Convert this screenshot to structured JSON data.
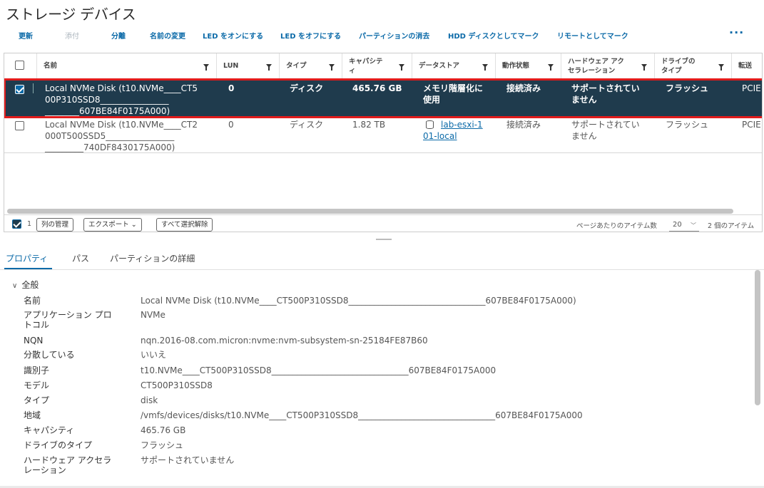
{
  "page": {
    "title": "ストレージ デバイス"
  },
  "toolbar": {
    "refresh": "更新",
    "attach": "添付",
    "detach": "分離",
    "rename": "名前の変更",
    "led_on": "LED をオンにする",
    "led_off": "LED をオフにする",
    "erase_partitions": "パーティションの消去",
    "mark_hdd": "HDD ディスクとしてマーク",
    "mark_remote": "リモートとしてマーク",
    "more": "⋮"
  },
  "grid": {
    "columns": {
      "name": "名前",
      "lun": "LUN",
      "type": "タイプ",
      "capacity": "キャパシティ",
      "datastore": "データストア",
      "op_state": "動作状態",
      "hw_accel": "ハードウェア アクセラレーション",
      "drive_type": "ドライブのタイプ",
      "transport": "転送"
    },
    "rows": [
      {
        "selected": true,
        "name_line1": "Local NVMe Disk (t10.NVMe____CT5",
        "name_line2": "00P310SSD8________________",
        "name_line3": "________607BE84F0175A000)",
        "lun": "0",
        "type": "ディスク",
        "capacity": "465.76 GB",
        "datastore_line1": "メモリ階層化に",
        "datastore_line2": "使用",
        "op_state": "接続済み",
        "hw_accel_line1": "サポートされてい",
        "hw_accel_line2": "ません",
        "drive_type": "フラッシュ",
        "transport": "PCIE"
      },
      {
        "selected": false,
        "name_line1": "Local NVMe Disk (t10.NVMe____CT2",
        "name_line2": "000T500SSD5________________",
        "name_line3": "_________740DF8430175A000)",
        "lun": "0",
        "type": "ディスク",
        "capacity": "1.82 TB",
        "datastore_line1": "lab-esxi-1",
        "datastore_line2": "01-local",
        "op_state": "接続済み",
        "hw_accel_line1": "サポートされてい",
        "hw_accel_line2": "ません",
        "drive_type": "フラッシュ",
        "transport": "PCIE"
      }
    ],
    "footer": {
      "selected_count": "1",
      "manage_columns": "列の管理",
      "export": "エクスポート ⌄",
      "clear_selection": "すべて選択解除",
      "items_per_page_label": "ページあたりのアイテム数",
      "items_per_page": "20",
      "total_items": "2 個のアイテム"
    }
  },
  "tabs": {
    "properties": "プロパティ",
    "paths": "パス",
    "partition_details": "パーティションの詳細"
  },
  "properties": {
    "section": "全般",
    "items": [
      {
        "label": "名前",
        "value": "Local NVMe Disk (t10.NVMe____CT500P310SSD8________________________________607BE84F0175A000)"
      },
      {
        "label": "アプリケーション プロトコル",
        "value": "NVMe"
      },
      {
        "label": "NQN",
        "value": "nqn.2016-08.com.micron:nvme:nvm-subsystem-sn-25184FE87B60"
      },
      {
        "label": "分散している",
        "value": "いいえ"
      },
      {
        "label": "識別子",
        "value": "t10.NVMe____CT500P310SSD8________________________________607BE84F0175A000"
      },
      {
        "label": "モデル",
        "value": "CT500P310SSD8"
      },
      {
        "label": "タイプ",
        "value": "disk"
      },
      {
        "label": "地域",
        "value": "/vmfs/devices/disks/t10.NVMe____CT500P310SSD8________________________________607BE84F0175A000"
      },
      {
        "label": "キャパシティ",
        "value": "465.76 GB"
      },
      {
        "label": "ドライブのタイプ",
        "value": "フラッシュ"
      },
      {
        "label": "ハードウェア アクセラレーション",
        "value": "サポートされていません"
      }
    ]
  }
}
